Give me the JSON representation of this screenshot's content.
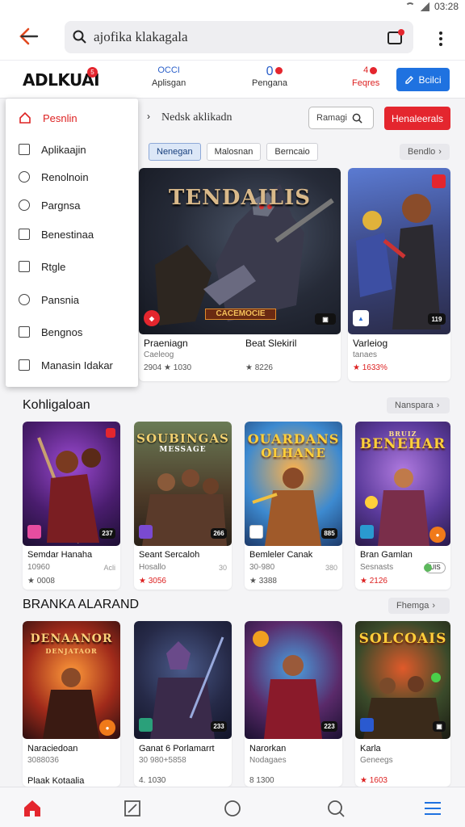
{
  "status": {
    "time": "03:28"
  },
  "search": {
    "value": "ajofika klakagala"
  },
  "appbar": {
    "logo": "ADLKUAI",
    "logo_badge": "5",
    "nav": [
      {
        "top": "OCCI",
        "label": "Aplisgan"
      },
      {
        "top": "0",
        "label": "Pengana"
      },
      {
        "top": "4",
        "label": "Feqres"
      }
    ],
    "action_label": "Bcilci"
  },
  "toolbar": {
    "breadcrumb": "Nedsk aklikadn",
    "search_label": "Ramagi",
    "red_button": "Henaleerals"
  },
  "chips": [
    "Nenegan",
    "Malosnan",
    "Berncaio"
  ],
  "chips_more": "Bendlo",
  "dropdown": [
    {
      "label": "Pesnlin",
      "icon": "home-icon"
    },
    {
      "label": "Aplikaajin",
      "icon": "apps-icon"
    },
    {
      "label": "Renolnoin",
      "icon": "circle-icon"
    },
    {
      "label": "Pargnsa",
      "icon": "clock-icon"
    },
    {
      "label": "Benestinaa",
      "icon": "puzzle-icon"
    },
    {
      "label": "Rtgle",
      "icon": "tag-icon"
    },
    {
      "label": "Pansnia",
      "icon": "cloud-icon"
    },
    {
      "label": "Bengnos",
      "icon": "box-icon"
    },
    {
      "label": "Manasin Idakar",
      "icon": "box2-icon"
    }
  ],
  "featured": [
    {
      "art_title": "TENDAILIS",
      "art_sub": "CACEMOCIE",
      "title": "Praeniagn",
      "subtitle": "Beat Slekiril",
      "line2": "Caeleog",
      "line3": "2904 ★ 1030",
      "rating": "★ 8226"
    },
    {
      "art_title": "",
      "title": "Varleiog",
      "line2": "tanaes",
      "rating": "★ 1633%",
      "badge": "119"
    }
  ],
  "sections": [
    {
      "title": "Kohligaloan",
      "more": "Nanspara",
      "items": [
        {
          "art_title": "",
          "title": "Semdar Hanaha",
          "line2": "10960",
          "side": "Acli",
          "rating": "★ 0008",
          "badge": "237"
        },
        {
          "art_title": "SOUBINGAS",
          "art_sub": "MESSAGE",
          "title": "Seant Sercaloh",
          "line2": "Hosallo",
          "side": "30",
          "rating": "★ 3056",
          "badge": "266"
        },
        {
          "art_title": "OUARDANS",
          "art_sub": "OLHANE",
          "title": "Bemleler Canak",
          "line2": "30-980",
          "side": "380",
          "rating": "★ 3388",
          "badge": "885"
        },
        {
          "art_title": "BENEHAR",
          "art_sub": "BRUIZ",
          "title": "Bran Gamlan",
          "line2": "Sesnasts",
          "rating": "★ 2126",
          "toggle": "UIS"
        }
      ]
    },
    {
      "title": "BRANKA ALARAND",
      "more": "Fhemga",
      "items": [
        {
          "art_title": "DENAANOR",
          "art_sub": "DENJATAOR",
          "title": "Naraciedoan",
          "line2": "3088036",
          "line3": "Plaak Kotaalia",
          "rating": ""
        },
        {
          "art_title": "",
          "title": "Ganat 6 Porlamarrt",
          "line2": "30 980+5858",
          "line3": "4. 1030",
          "badge": "233"
        },
        {
          "art_title": "",
          "title": "Narorkan",
          "line2": "Nodagaes",
          "line3": "8 1300",
          "badge": "223"
        },
        {
          "art_title": "SOLCOAIS",
          "art_sub": "",
          "title": "Karla",
          "line2": "Geneegs",
          "rating": "★ 1603"
        }
      ]
    }
  ]
}
